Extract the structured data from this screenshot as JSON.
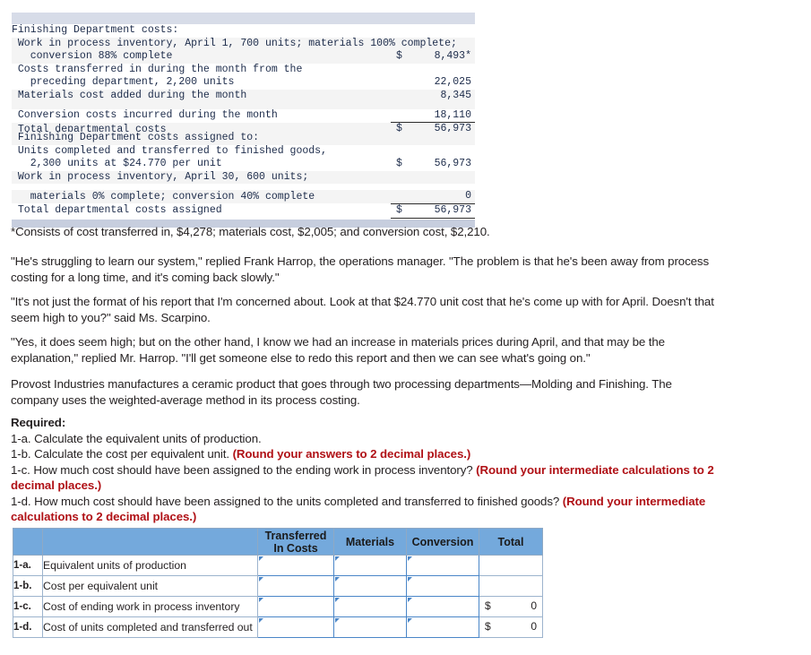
{
  "exhibit_one": {
    "rows": [
      {
        "label": "Finishing Department costs:",
        "currency": "",
        "amount": "",
        "stripe": false,
        "rule": "none"
      },
      {
        "label": " Work in process inventory, April 1, 700 units; materials 100% complete;",
        "currency": "",
        "amount": "",
        "stripe": true,
        "rule": "none"
      },
      {
        "label": "   conversion 88% complete",
        "currency": "$",
        "amount": "8,493*",
        "stripe": true,
        "rule": "none"
      },
      {
        "label": " Costs transferred in during the month from the",
        "currency": "",
        "amount": "",
        "stripe": false,
        "rule": "none"
      },
      {
        "label": "   preceding department, 2,200 units",
        "currency": "",
        "amount": "22,025",
        "stripe": false,
        "rule": "none"
      },
      {
        "label": " Materials cost added during the month",
        "currency": "",
        "amount": "8,345",
        "stripe": true,
        "rule": "none"
      },
      {
        "label": " Conversion costs incurred during the month",
        "currency": "",
        "amount": "18,110",
        "stripe": false,
        "rule": "single"
      },
      {
        "label": " Total departmental costs",
        "currency": "$",
        "amount": "56,973",
        "stripe": true,
        "rule": "double"
      }
    ]
  },
  "exhibit_two": {
    "rows": [
      {
        "label": " Finishing Department costs assigned to:",
        "currency": "",
        "amount": "",
        "stripe": true,
        "rule": "none"
      },
      {
        "label": " Units completed and transferred to finished goods,",
        "currency": "",
        "amount": "",
        "stripe": false,
        "rule": "none"
      },
      {
        "label": "   2,300 units at $24.770 per unit",
        "currency": "$",
        "amount": "56,973",
        "stripe": false,
        "rule": "none"
      },
      {
        "label": " Work in process inventory, April 30, 600 units;",
        "currency": "",
        "amount": "",
        "stripe": true,
        "rule": "none"
      },
      {
        "label": "   materials 0% complete; conversion 40% complete",
        "currency": "",
        "amount": "0",
        "stripe": true,
        "rule": "single"
      },
      {
        "label": " Total departmental costs assigned",
        "currency": "$",
        "amount": "56,973",
        "stripe": false,
        "rule": "double"
      }
    ]
  },
  "footnote": "*Consists of cost transferred in, $4,278; materials cost, $2,005; and conversion cost, $2,210.",
  "paragraphs": {
    "p1": "\"He's struggling to learn our system,\" replied Frank Harrop, the operations manager. \"The problem is that he's been away from process costing for a long time, and it's coming back slowly.\"",
    "p2": "\"It's not just the format of his report that I'm concerned about. Look at that $24.770 unit cost that he's come up with for April. Doesn't that seem high to you?\" said Ms. Scarpino.",
    "p3": "\"Yes, it does seem high; but on the other hand, I know we had an increase in materials prices during April, and that may be the explanation,\" replied Mr. Harrop. \"I'll get someone else to redo this report and then we can see what's going on.\"",
    "p4": "Provost Industries manufactures a ceramic product that goes through two processing departments—Molding and Finishing. The company uses the weighted-average method in its process costing."
  },
  "required": {
    "heading": "Required:",
    "items": [
      {
        "text": "1-a. Calculate the equivalent units of production.",
        "emphasis": ""
      },
      {
        "text": "1-b. Calculate the cost per equivalent unit. ",
        "emphasis": "(Round your answers to 2 decimal places.)"
      },
      {
        "text": "1-c. How much cost should have been assigned to the ending work in process inventory? ",
        "emphasis": "(Round your intermediate calculations to 2 decimal places.)"
      },
      {
        "text": "1-d. How much cost should have been assigned to the units completed and transferred to finished goods? ",
        "emphasis": "(Round your intermediate calculations to 2 decimal places.)"
      }
    ]
  },
  "answer_table": {
    "headers": [
      "",
      "",
      "Transferred In Costs",
      "Materials",
      "Conversion",
      "Total"
    ],
    "header_tic_line1": "Transferred",
    "header_tic_line2": "In Costs",
    "header_materials": "Materials",
    "header_conversion": "Conversion",
    "header_total": "Total",
    "rows": [
      {
        "idx": "1-a.",
        "desc": "Equivalent units of production",
        "total_currency": "",
        "total_value": ""
      },
      {
        "idx": "1-b.",
        "desc": "Cost per equivalent unit",
        "total_currency": "",
        "total_value": ""
      },
      {
        "idx": "1-c.",
        "desc": "Cost of ending work in process inventory",
        "total_currency": "$",
        "total_value": "0"
      },
      {
        "idx": "1-d.",
        "desc": "Cost of units completed and transferred out",
        "total_currency": "$",
        "total_value": "0"
      }
    ]
  },
  "colors": {
    "header_blue": "#74a9dc",
    "exhibit_gray": "#d7dce8",
    "red_emphasis": "#b01116",
    "input_border": "#4a86c8"
  }
}
